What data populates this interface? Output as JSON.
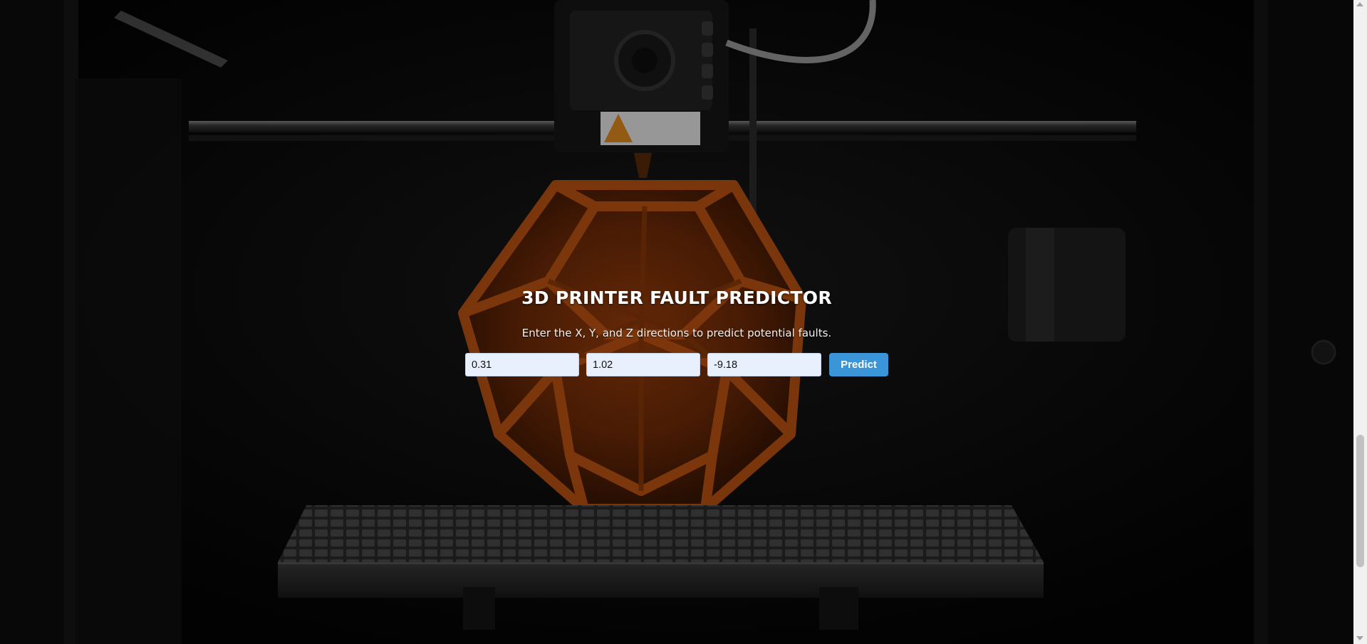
{
  "app": {
    "title": "3D PRINTER FAULT PREDICTOR",
    "subtitle": "Enter the X, Y, and Z directions to predict potential faults."
  },
  "form": {
    "x_value": "0.31",
    "y_value": "1.02",
    "z_value": "-9.18",
    "predict_label": "Predict"
  },
  "colors": {
    "button_bg": "#3b95d9",
    "input_bg": "#e8f0fe",
    "print_orange": "#c45612"
  },
  "icons": {
    "scroll_up": "scroll-up-arrow-icon",
    "scroll_down": "scroll-down-arrow-icon"
  }
}
